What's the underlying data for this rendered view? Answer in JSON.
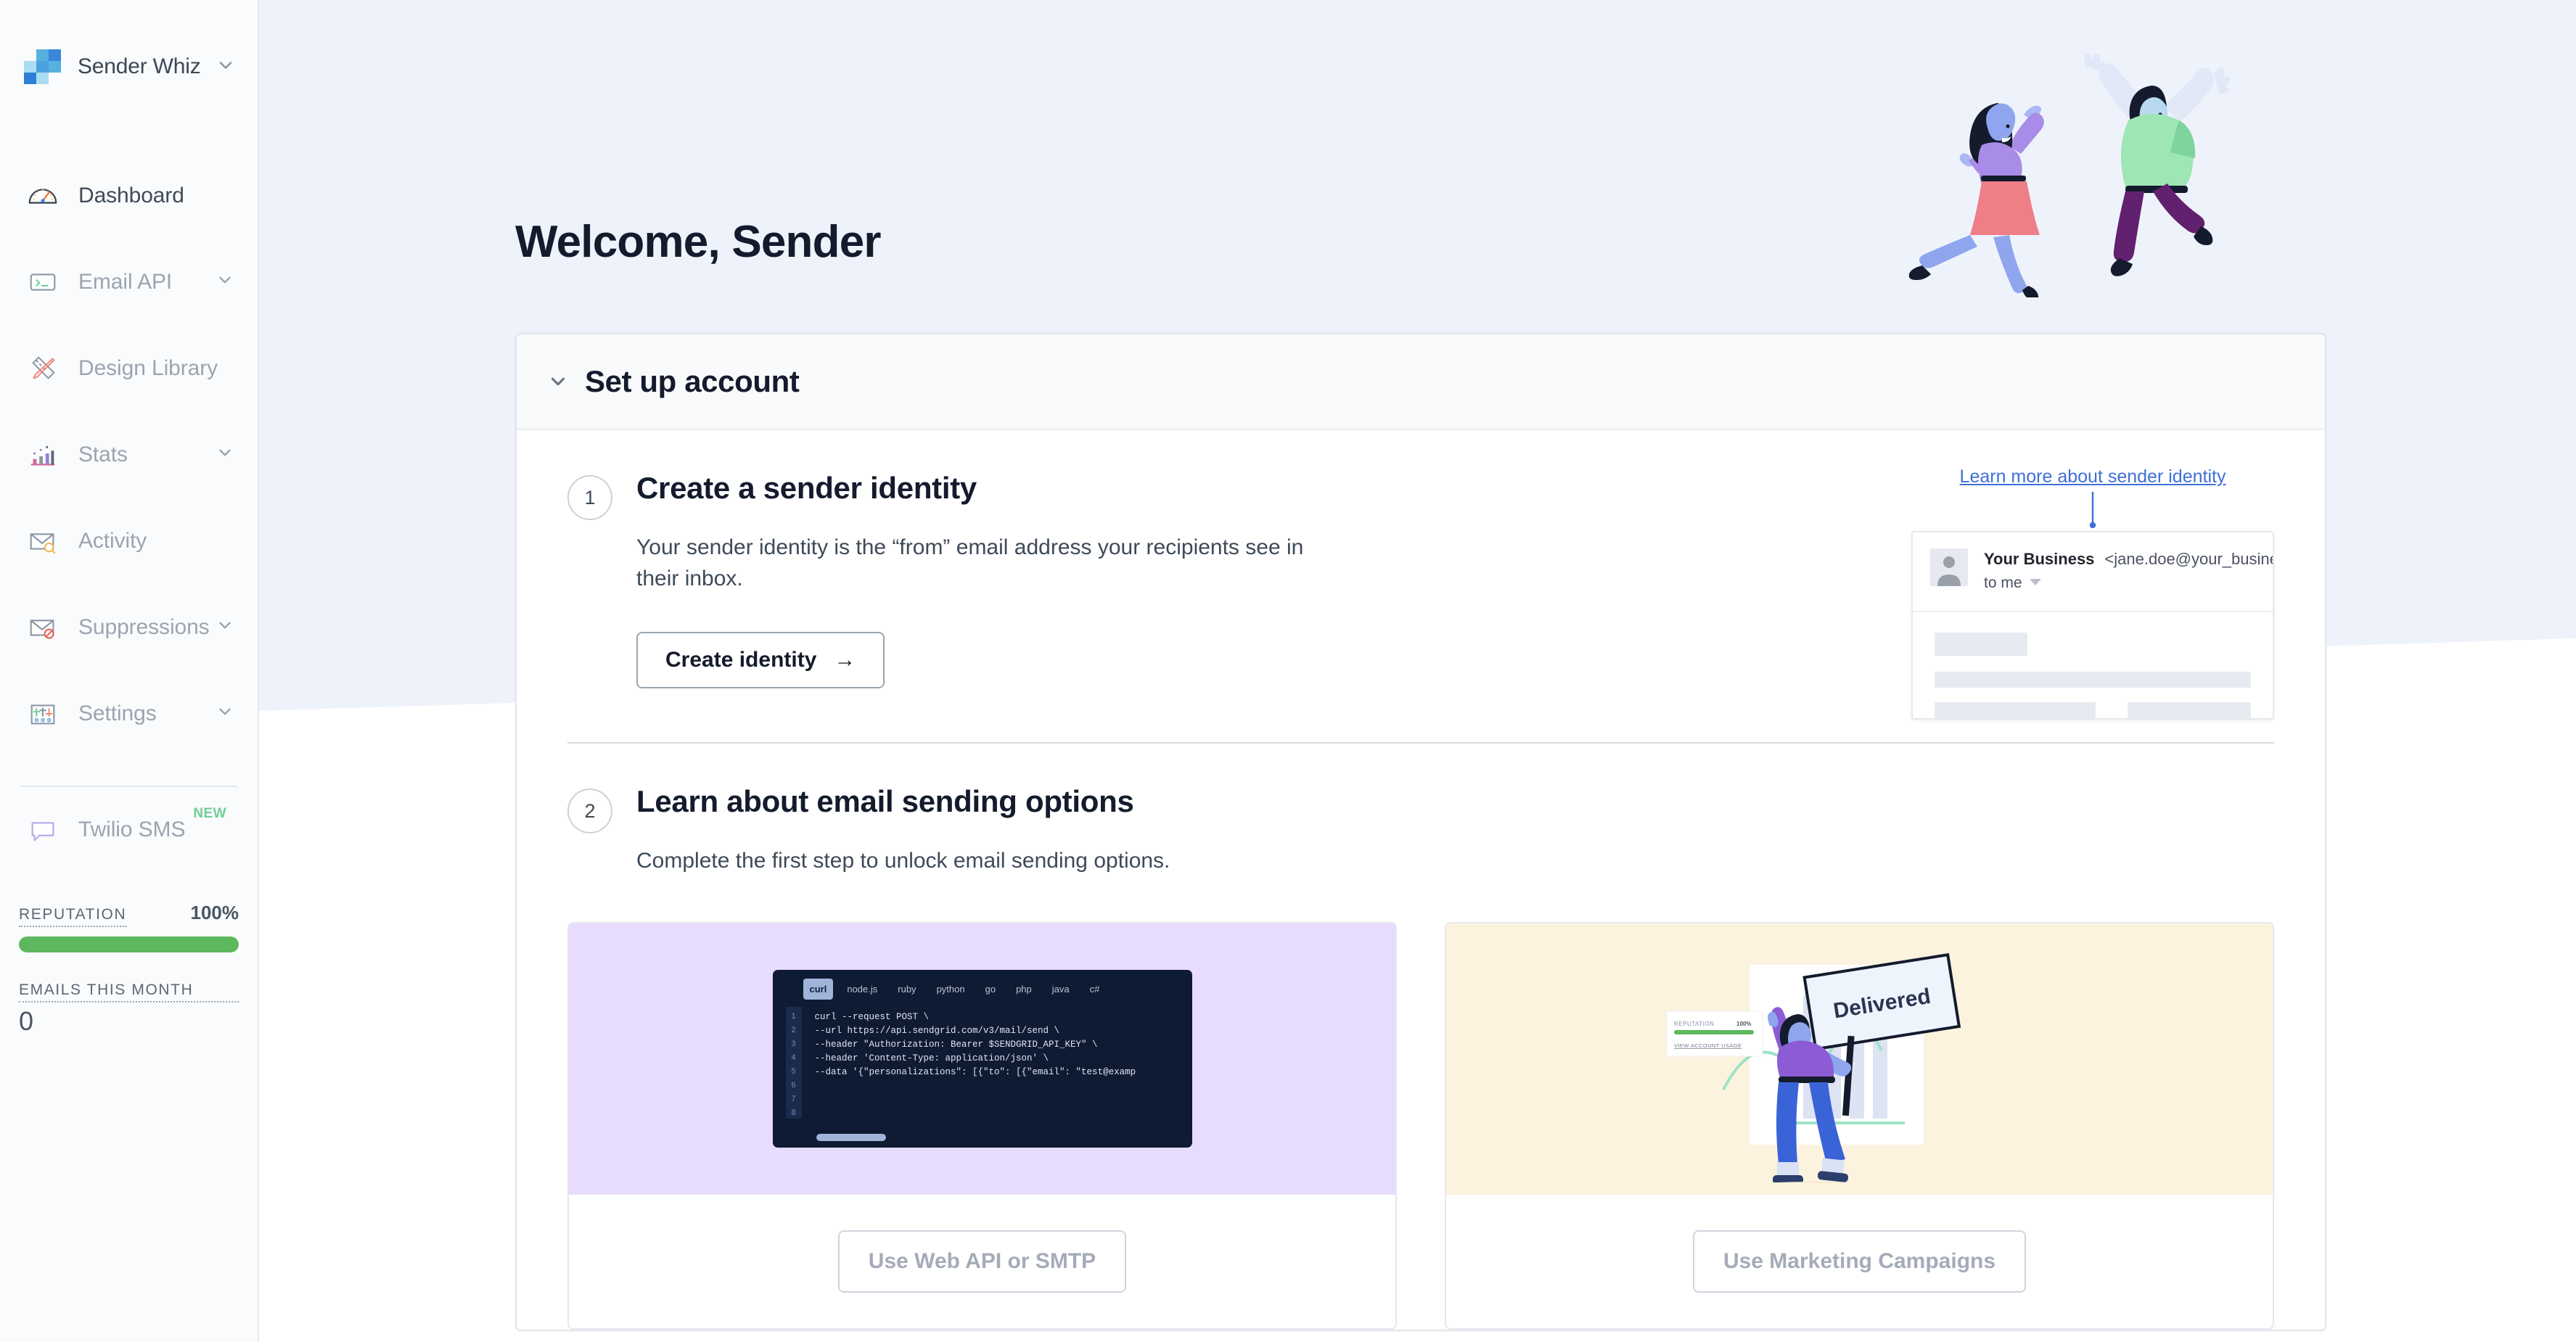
{
  "sidebar": {
    "brand": {
      "name": "Sender Whiz",
      "logo_icon": "sendgrid-logo-icon",
      "caret_icon": "chevron-down-icon"
    },
    "items": [
      {
        "label": "Dashboard",
        "icon": "gauge-icon",
        "has_caret": false,
        "muted": false,
        "active": true
      },
      {
        "label": "Email API",
        "icon": "terminal-card-icon",
        "has_caret": true,
        "muted": true,
        "active": false
      },
      {
        "label": "Design Library",
        "icon": "ruler-pencil-icon",
        "has_caret": false,
        "muted": true,
        "active": false
      },
      {
        "label": "Stats",
        "icon": "bar-chart-icon",
        "has_caret": true,
        "muted": true,
        "active": false
      },
      {
        "label": "Activity",
        "icon": "envelope-search-icon",
        "has_caret": false,
        "muted": true,
        "active": false
      },
      {
        "label": "Suppressions",
        "icon": "envelope-block-icon",
        "has_caret": true,
        "muted": true,
        "active": false
      },
      {
        "label": "Settings",
        "icon": "sliders-icon",
        "has_caret": true,
        "muted": true,
        "active": false
      }
    ],
    "promo": {
      "label": "Twilio SMS",
      "badge": "NEW",
      "icon": "chat-bubble-icon"
    },
    "reputation": {
      "label": "REPUTATION",
      "percent_text": "100%",
      "percent_value": 100,
      "bar_color": "#5cb85c"
    },
    "emails_month": {
      "label": "EMAILS THIS MONTH",
      "value": "0"
    }
  },
  "hero": {
    "title": "Welcome, Sender",
    "art_icon": "two-people-jumping-illustration"
  },
  "panel": {
    "title": "Set up account",
    "caret_icon": "chevron-down-icon",
    "steps": [
      {
        "number": "1",
        "title": "Create a sender identity",
        "description": "Your sender identity is the “from” email address your recipients see in their inbox.",
        "cta_label": "Create identity",
        "cta_arrow": "→"
      },
      {
        "number": "2",
        "title": "Learn about email sending options",
        "description": "Complete the first step to unlock email sending options."
      }
    ]
  },
  "preview": {
    "link_label": "Learn more about sender identity",
    "avatar_icon": "person-avatar-icon",
    "business_name": "Your Business",
    "email_address": "<jane.doe@your_business.com>",
    "to_label": "to me",
    "to_caret_icon": "caret-down-icon"
  },
  "code_mock": {
    "tabs": [
      "curl",
      "node.js",
      "ruby",
      "python",
      "go",
      "php",
      "java",
      "c#"
    ],
    "active_tab": "curl",
    "line_numbers": [
      "1",
      "2",
      "3",
      "4",
      "5",
      "6",
      "7",
      "8"
    ],
    "lines": [
      "curl --request POST \\",
      "--url https://api.sendgrid.com/v3/mail/send \\",
      "--header \"Authorization: Bearer $SENDGRID_API_KEY\" \\",
      "--header 'Content-Type: application/json' \\",
      "--data '{\"personalizations\": [{\"to\": [{\"email\": \"test@examp"
    ]
  },
  "marketing_mock": {
    "sign_label": "Delivered",
    "mini_card": {
      "reputation_label": "REPUTATION",
      "reputation_value": "100%",
      "link_label": "VIEW ACCOUNT USAGE"
    }
  },
  "options": [
    {
      "button_label": "Use Web API or SMTP",
      "art": "code-snippet-illustration",
      "art_bg": "#e7dcfb"
    },
    {
      "button_label": "Use Marketing Campaigns",
      "art": "delivered-sign-illustration",
      "art_bg": "#fcf3df"
    }
  ],
  "colors": {
    "brand_blue": "#3f8fe0",
    "accent_link": "#3f6fd8",
    "page_bg": "#ffffff",
    "hero_bg": "#eef3fb",
    "sidebar_bg": "#fafbfc"
  }
}
